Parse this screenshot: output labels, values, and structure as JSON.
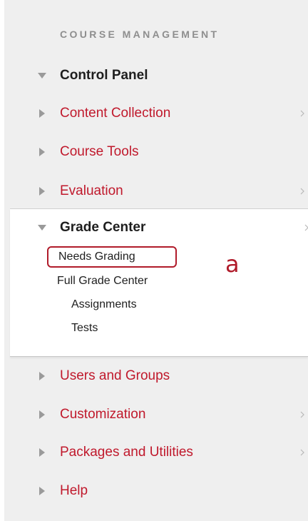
{
  "sidebar": {
    "heading": "COURSE MANAGEMENT",
    "control_panel": "Control Panel",
    "items_top": [
      {
        "label": "Content Collection",
        "has_submenu": true
      },
      {
        "label": "Course Tools",
        "has_submenu": false
      },
      {
        "label": "Evaluation",
        "has_submenu": true
      }
    ],
    "grade_center": {
      "label": "Grade Center",
      "children": [
        {
          "label": "Needs Grading"
        },
        {
          "label": "Full Grade Center"
        },
        {
          "label": "Assignments"
        },
        {
          "label": "Tests"
        }
      ]
    },
    "items_bottom": [
      {
        "label": "Users and Groups",
        "has_submenu": false
      },
      {
        "label": "Customization",
        "has_submenu": true
      },
      {
        "label": "Packages and Utilities",
        "has_submenu": true
      },
      {
        "label": "Help",
        "has_submenu": false
      }
    ]
  },
  "annotation": {
    "marker": "a"
  },
  "colors": {
    "link": "#c0192c",
    "highlight": "#b01b2a",
    "panel_bg": "#efefef",
    "heading": "#8e8e8e"
  }
}
